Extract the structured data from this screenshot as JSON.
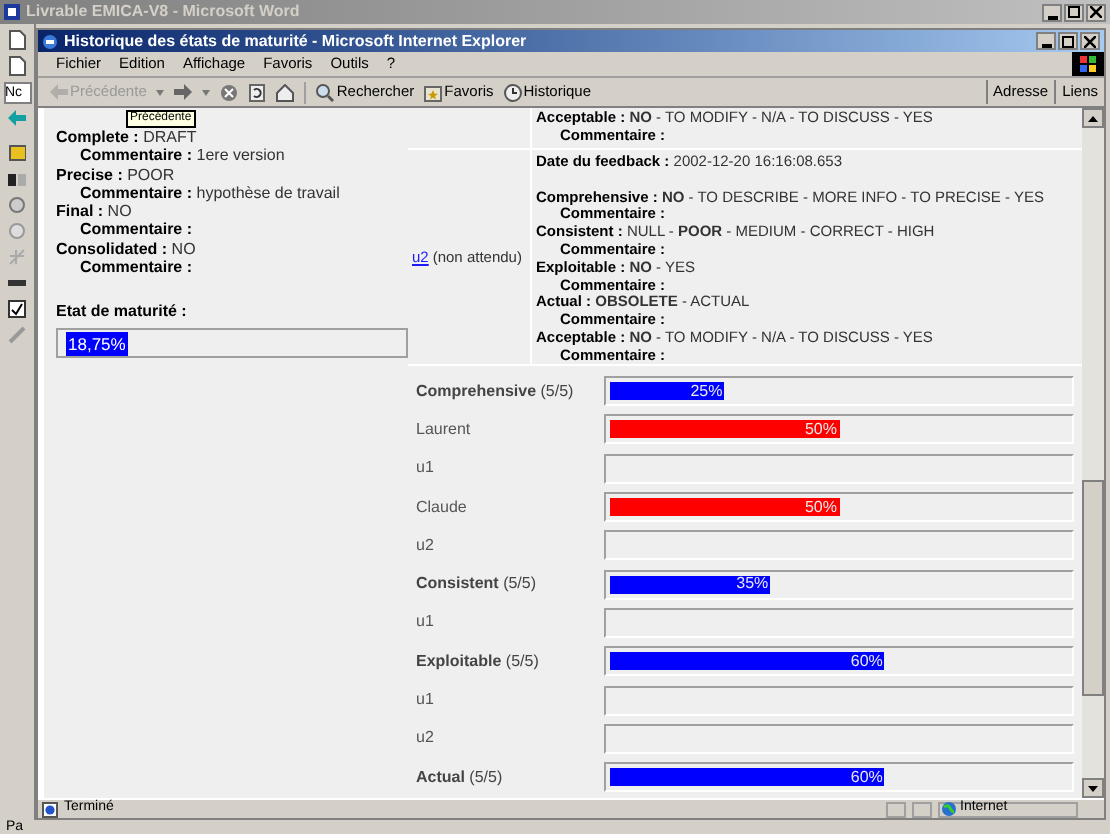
{
  "word_window": {
    "title": "Livrable EMICA-V8 - Microsoft Word",
    "style_box": "Nc",
    "status_bar": "Pa"
  },
  "ie_window": {
    "title": "Historique des états de maturité - Microsoft Internet Explorer",
    "menu": [
      "Fichier",
      "Edition",
      "Affichage",
      "Favoris",
      "Outils",
      "?"
    ],
    "toolbar": [
      {
        "kind": "back",
        "label": "Précédente",
        "disabled": true
      },
      {
        "kind": "forward",
        "disabled": false
      },
      {
        "kind": "stop"
      },
      {
        "kind": "refresh"
      },
      {
        "kind": "home"
      },
      {
        "kind": "search",
        "label": "Rechercher"
      },
      {
        "kind": "favorites",
        "label": "Favoris"
      },
      {
        "kind": "history",
        "label": "Historique"
      }
    ],
    "address_label": "Adresse",
    "links_label": "Liens",
    "tooltip": "Précédente",
    "status_bar": {
      "text": "Terminé",
      "zone": "Internet"
    }
  },
  "left_panel": {
    "criteria": [
      {
        "label": "Complete :",
        "value": "DRAFT",
        "comment_label": "Commentaire :",
        "comment": "1ere version"
      },
      {
        "label": "Precise :",
        "value": "POOR",
        "comment_label": "Commentaire :",
        "comment": "hypothèse de travail"
      },
      {
        "label": "Final :",
        "value": "NO",
        "comment_label": "Commentaire :"
      },
      {
        "label": "Consolidated :",
        "value": "NO",
        "comment_label": "Commentaire :"
      }
    ],
    "maturity": {
      "label": "Etat de maturité :",
      "value": "18,75%"
    }
  },
  "feedback_table": {
    "previous_tail": [
      {
        "label": "Acceptable :",
        "value": "**NO** - TO MODIFY - N/A - TO DISCUSS - YES",
        "comment_label": "Commentaire :"
      }
    ],
    "rows": [
      {
        "user": "u2",
        "note": "(non attendu)",
        "date_label": "Date du feedback :",
        "date": "2002-12-20 16:16:08.653",
        "criteria": [
          {
            "label": "Comprehensive :",
            "value": "**NO** - TO DESCRIBE - MORE INFO - TO PRECISE - YES",
            "comment_label": "Commentaire :"
          },
          {
            "label": "Consistent :",
            "value": "NULL - **POOR** - MEDIUM - CORRECT - HIGH",
            "comment_label": "Commentaire :"
          },
          {
            "label": "Exploitable :",
            "value": "**NO** - YES",
            "comment_label": "Commentaire :"
          },
          {
            "label": "Actual :",
            "value": "**OBSOLETE** - ACTUAL",
            "comment_label": "Commentaire :"
          },
          {
            "label": "Acceptable :",
            "value": "**NO** - TO MODIFY - N/A - TO DISCUSS - YES",
            "comment_label": "Commentaire :"
          }
        ]
      }
    ]
  },
  "bars": [
    {
      "kind": "criterion",
      "label": "**Comprehensive** (5/5)",
      "level": 0.25,
      "reading": "25%",
      "color": "#0000ff"
    },
    {
      "kind": "user",
      "label": "Laurent",
      "level": 0.5,
      "reading": "50%",
      "color": "#ff0000"
    },
    {
      "kind": "user",
      "label": "u1"
    },
    {
      "kind": "user",
      "label": "Claude",
      "level": 0.5,
      "reading": "50%",
      "color": "#ff0000"
    },
    {
      "kind": "user",
      "label": "u2"
    },
    {
      "kind": "criterion",
      "label": "**Consistent** (5/5)",
      "level": 0.35,
      "reading": "35%",
      "color": "#0000ff"
    },
    {
      "kind": "user",
      "label": "u1"
    },
    {
      "kind": "criterion",
      "label": "**Exploitable** (5/5)",
      "level": 0.6,
      "reading": "60%",
      "color": "#0000ff"
    },
    {
      "kind": "user",
      "label": "u1"
    },
    {
      "kind": "user",
      "label": "u2"
    },
    {
      "kind": "criterion",
      "label": "**Actual** (5/5)",
      "level": 0.6,
      "reading": "60%",
      "color": "#0000ff"
    }
  ]
}
